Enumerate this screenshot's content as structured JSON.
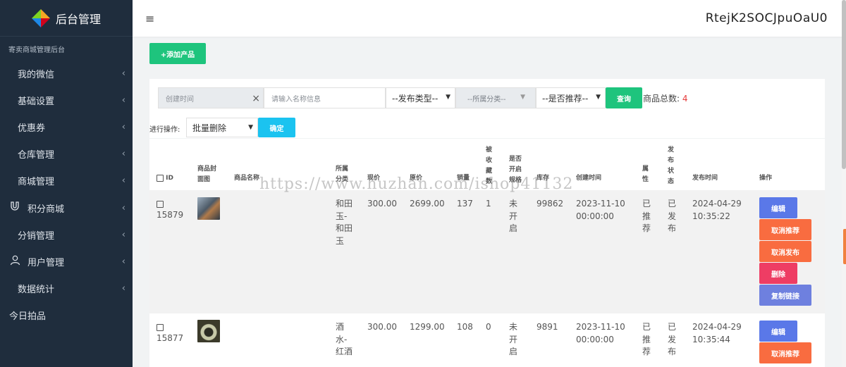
{
  "brand": {
    "title": "后台管理",
    "subtitle": "寄卖商城管理后台"
  },
  "sidebar": {
    "items": [
      {
        "label": "我的微信",
        "icon": "",
        "chevron": "‹"
      },
      {
        "label": "基础设置",
        "icon": "",
        "chevron": "‹"
      },
      {
        "label": "优惠券",
        "icon": "",
        "chevron": "‹"
      },
      {
        "label": "仓库管理",
        "icon": "",
        "chevron": "‹"
      },
      {
        "label": "商城管理",
        "icon": "",
        "chevron": "‹"
      },
      {
        "label": "积分商城",
        "icon": "magnet-icon",
        "chevron": "‹"
      },
      {
        "label": "分销管理",
        "icon": "",
        "chevron": "‹"
      },
      {
        "label": "用户管理",
        "icon": "user-icon",
        "chevron": "‹"
      },
      {
        "label": "数据统计",
        "icon": "",
        "chevron": "‹"
      },
      {
        "label": "今日拍品",
        "icon": "",
        "chevron": ""
      }
    ]
  },
  "topbar": {
    "menu_icon": "≡",
    "user": "RtejK2SOCJpuOaU0"
  },
  "toolbar": {
    "add_label": "+添加产品"
  },
  "filters": {
    "date_placeholder": "创建时间",
    "clear": "×",
    "name_placeholder": "请输入名称信息",
    "type_select": "--发布类型--",
    "category_select": "--所属分类--",
    "recommend_select": "--是否推荐--",
    "query_label": "查询",
    "total_label": "商品总数:",
    "total_count": "4",
    "batch_label": "进行操作:",
    "batch_select": "批量删除",
    "confirm_label": "确定"
  },
  "table": {
    "headers": {
      "id": "ID",
      "cover": "商品封\n面图",
      "name": "商品名称",
      "category": "所属\n分类",
      "price": "现价",
      "orig_price": "原价",
      "sales": "销量",
      "collected": "被\n收\n藏\n数",
      "spec": "是否\n开启\n规格",
      "stock": "库存",
      "created": "创建时间",
      "attr": "属\n性",
      "status": "发\n布\n状\n态",
      "published": "发布时间",
      "actions": "操作"
    },
    "rows": [
      {
        "id": "15879",
        "name": "",
        "category": "和田\n玉-\n和田\n玉",
        "price": "300.00",
        "orig_price": "2699.00",
        "sales": "137",
        "collected": "1",
        "spec": "未\n开\n启",
        "stock": "99862",
        "created": "2023-11-10\n00:00:00",
        "attr": "已\n推\n荐",
        "status": "已\n发\n布",
        "published": "2024-04-29\n10:35:22",
        "actions": [
          "编辑",
          "取消推荐",
          "取消发布",
          "删除",
          "复制链接"
        ]
      },
      {
        "id": "15877",
        "name": "",
        "category": "酒\n水-\n红酒",
        "price": "300.00",
        "orig_price": "1299.00",
        "sales": "108",
        "collected": "0",
        "spec": "未\n开\n启",
        "stock": "9891",
        "created": "2023-11-10\n00:00:00",
        "attr": "已\n推\n荐",
        "status": "已\n发\n布",
        "published": "2024-04-29\n10:35:44",
        "actions": [
          "编辑",
          "取消推荐"
        ]
      }
    ]
  },
  "watermark": "https://www.huzhan.com/ishop41132",
  "colors": {
    "sidebar": "#1f2d3d",
    "green": "#1ec47d",
    "cyan": "#1bc3f0",
    "blue": "#5a78e8",
    "orange": "#f96c40",
    "red": "#ee3d64"
  }
}
